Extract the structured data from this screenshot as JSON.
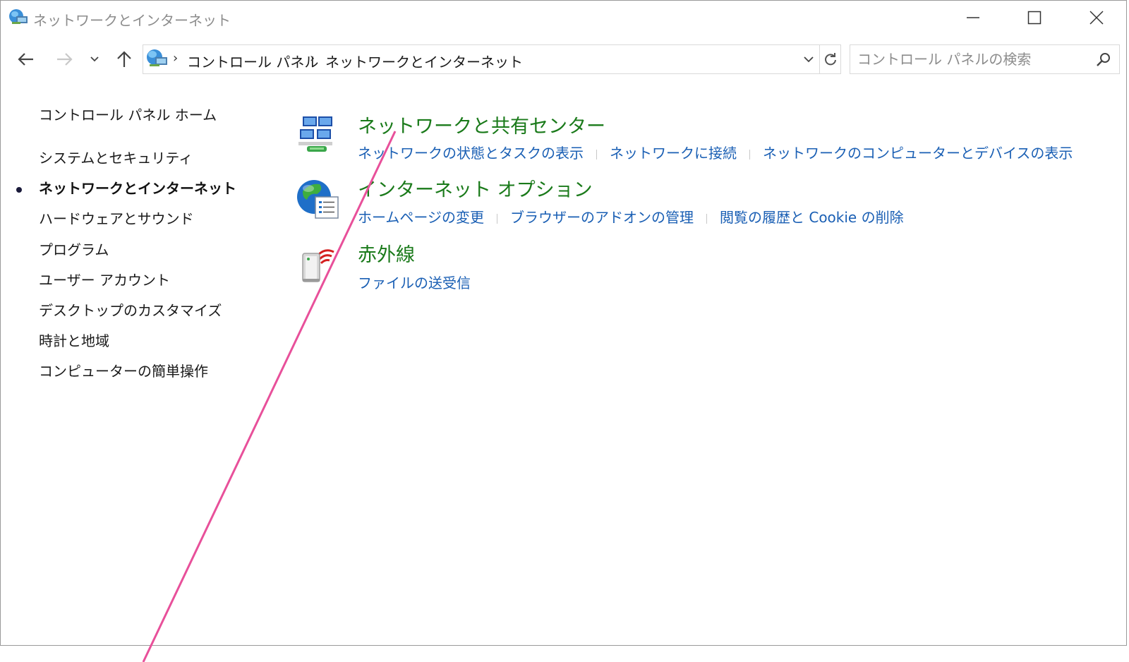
{
  "window": {
    "title": "ネットワークとインターネット"
  },
  "navigation": {
    "breadcrumb": [
      "コントロール パネル",
      "ネットワークとインターネット"
    ],
    "search_placeholder": "コントロール パネルの検索"
  },
  "sidebar": {
    "items": [
      {
        "label": "コントロール パネル ホーム",
        "active": false
      },
      {
        "label": "システムとセキュリティ",
        "active": false
      },
      {
        "label": "ネットワークとインターネット",
        "active": true
      },
      {
        "label": "ハードウェアとサウンド",
        "active": false
      },
      {
        "label": "プログラム",
        "active": false
      },
      {
        "label": "ユーザー アカウント",
        "active": false
      },
      {
        "label": "デスクトップのカスタマイズ",
        "active": false
      },
      {
        "label": "時計と地域",
        "active": false
      },
      {
        "label": "コンピューターの簡単操作",
        "active": false
      }
    ]
  },
  "categories": [
    {
      "icon": "network-sharing-center-icon",
      "title": "ネットワークと共有センター",
      "links": [
        "ネットワークの状態とタスクの表示",
        "ネットワークに接続",
        "ネットワークのコンピューターとデバイスの表示"
      ]
    },
    {
      "icon": "internet-options-globe-icon",
      "title": "インターネット オプション",
      "links": [
        "ホームページの変更",
        "ブラウザーのアドオンの管理",
        "閲覧の履歴と Cookie の削除"
      ]
    },
    {
      "icon": "infrared-icon",
      "title": "赤外線",
      "links": [
        "ファイルの送受信"
      ]
    }
  ],
  "colors": {
    "category_title": "#1a7a1a",
    "link": "#1a5fb4",
    "annotation_line": "#e8509a"
  }
}
